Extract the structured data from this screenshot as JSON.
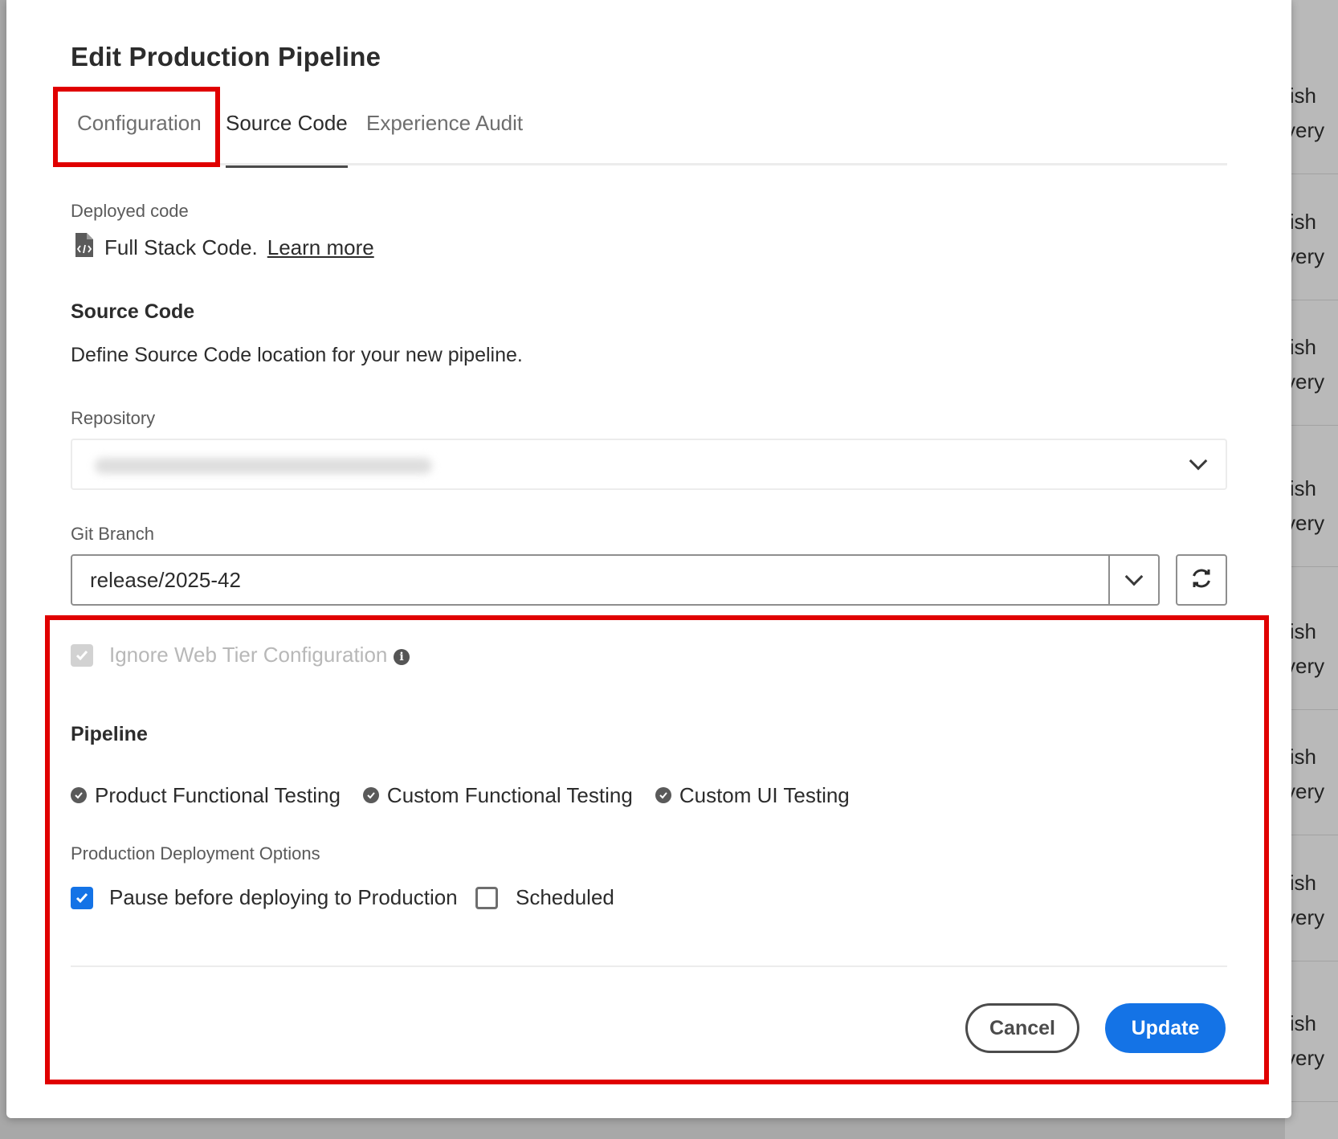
{
  "dialog": {
    "title": "Edit Production Pipeline",
    "tabs": [
      {
        "label": "Configuration"
      },
      {
        "label": "Source Code"
      },
      {
        "label": "Experience Audit"
      }
    ],
    "active_tab": "Source Code"
  },
  "deployed_code": {
    "label": "Deployed code",
    "value": "Full Stack Code.",
    "link": "Learn more",
    "icon": "code-file-icon"
  },
  "source_code": {
    "heading": "Source Code",
    "description": "Define Source Code location for your new pipeline."
  },
  "repository": {
    "label": "Repository",
    "value_redacted": true
  },
  "git_branch": {
    "label": "Git Branch",
    "value": "release/2025-42"
  },
  "ignore_web_tier": {
    "label": "Ignore Web Tier Configuration",
    "checked": true,
    "disabled": true
  },
  "pipeline": {
    "heading": "Pipeline",
    "items": [
      "Product Functional Testing",
      "Custom Functional Testing",
      "Custom UI Testing"
    ]
  },
  "production_options": {
    "label": "Production Deployment Options",
    "pause": {
      "label": "Pause before deploying to Production",
      "checked": true
    },
    "scheduled": {
      "label": "Scheduled",
      "checked": false
    }
  },
  "buttons": {
    "cancel": "Cancel",
    "update": "Update"
  },
  "background": {
    "rows": [
      {
        "l1": "lish",
        "l2": "very"
      },
      {
        "l1": "lish",
        "l2": "very"
      },
      {
        "l1": "lish",
        "l2": "very"
      },
      {
        "l1": "lish",
        "l2": "very"
      },
      {
        "l1": "lish",
        "l2": "very"
      },
      {
        "l1": "lish",
        "l2": "very"
      },
      {
        "l1": "lish",
        "l2": "very"
      },
      {
        "l1": "lish",
        "l2": "very"
      }
    ]
  },
  "colors": {
    "accent": "#1473e6",
    "highlight": "#e00000"
  }
}
